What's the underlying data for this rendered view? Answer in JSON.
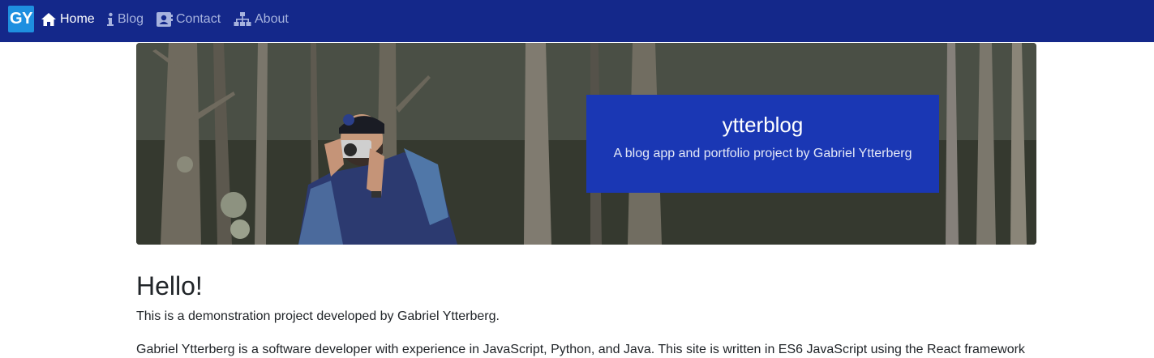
{
  "navbar": {
    "logo_text": "GY",
    "items": [
      {
        "label": "Home",
        "icon": "home-icon",
        "active": true
      },
      {
        "label": "Blog",
        "icon": "info-icon",
        "active": false
      },
      {
        "label": "Contact",
        "icon": "contact-card-icon",
        "active": false
      },
      {
        "label": "About",
        "icon": "sitemap-icon",
        "active": false
      }
    ]
  },
  "hero": {
    "title": "ytterblog",
    "subtitle": "A blog app and portfolio project by Gabriel Ytterberg"
  },
  "content": {
    "heading": "Hello!",
    "paragraphs": [
      "This is a demonstration project developed by Gabriel Ytterberg.",
      "Gabriel Ytterberg is a software developer with experience in JavaScript, Python, and Java. This site is written in ES6 JavaScript using the React framework"
    ]
  },
  "colors": {
    "navbar_bg": "#14288a",
    "logo_bg": "#1e8fe0",
    "hero_box_bg": "#1a37b4",
    "nav_inactive": "#a7b3de",
    "text": "#212529"
  }
}
